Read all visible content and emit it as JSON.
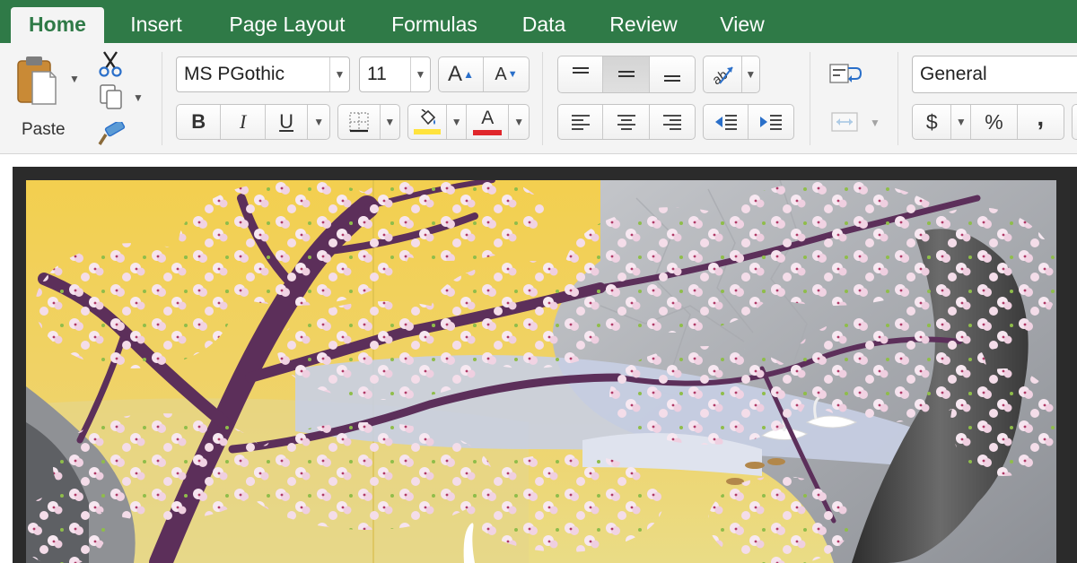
{
  "tabs": [
    {
      "label": "Home",
      "active": true
    },
    {
      "label": "Insert",
      "active": false
    },
    {
      "label": "Page Layout",
      "active": false
    },
    {
      "label": "Formulas",
      "active": false
    },
    {
      "label": "Data",
      "active": false
    },
    {
      "label": "Review",
      "active": false
    },
    {
      "label": "View",
      "active": false
    }
  ],
  "clipboard": {
    "paste_label": "Paste",
    "icons": [
      "clipboard-icon",
      "scissors-icon",
      "copy-icon",
      "format-painter-icon"
    ]
  },
  "font": {
    "name": "MS PGothic",
    "size": "11",
    "grow_label": "A",
    "shrink_label": "A",
    "bold_label": "B",
    "italic_label": "I",
    "underline_label": "U",
    "font_color_label": "A",
    "highlight_color": "#ffe33d",
    "font_color": "#e0262b"
  },
  "alignment": {
    "icons": [
      "align-top-icon",
      "align-middle-icon",
      "align-bottom-icon",
      "orientation-icon",
      "align-left-icon",
      "align-center-icon",
      "align-right-icon",
      "decrease-indent-icon",
      "increase-indent-icon",
      "wrap-text-icon",
      "merge-center-icon"
    ]
  },
  "number": {
    "format": "General",
    "currency_label": "$",
    "percent_label": "%",
    "comma_label": ","
  },
  "colors": {
    "tab_bar": "#2f7a47",
    "ribbon": "#f4f4f4",
    "frame": "#2b2b2b",
    "accent_blue": "#2a6fc9"
  },
  "artwork": {
    "subject": "cherry blossoms, swans and rocks"
  }
}
